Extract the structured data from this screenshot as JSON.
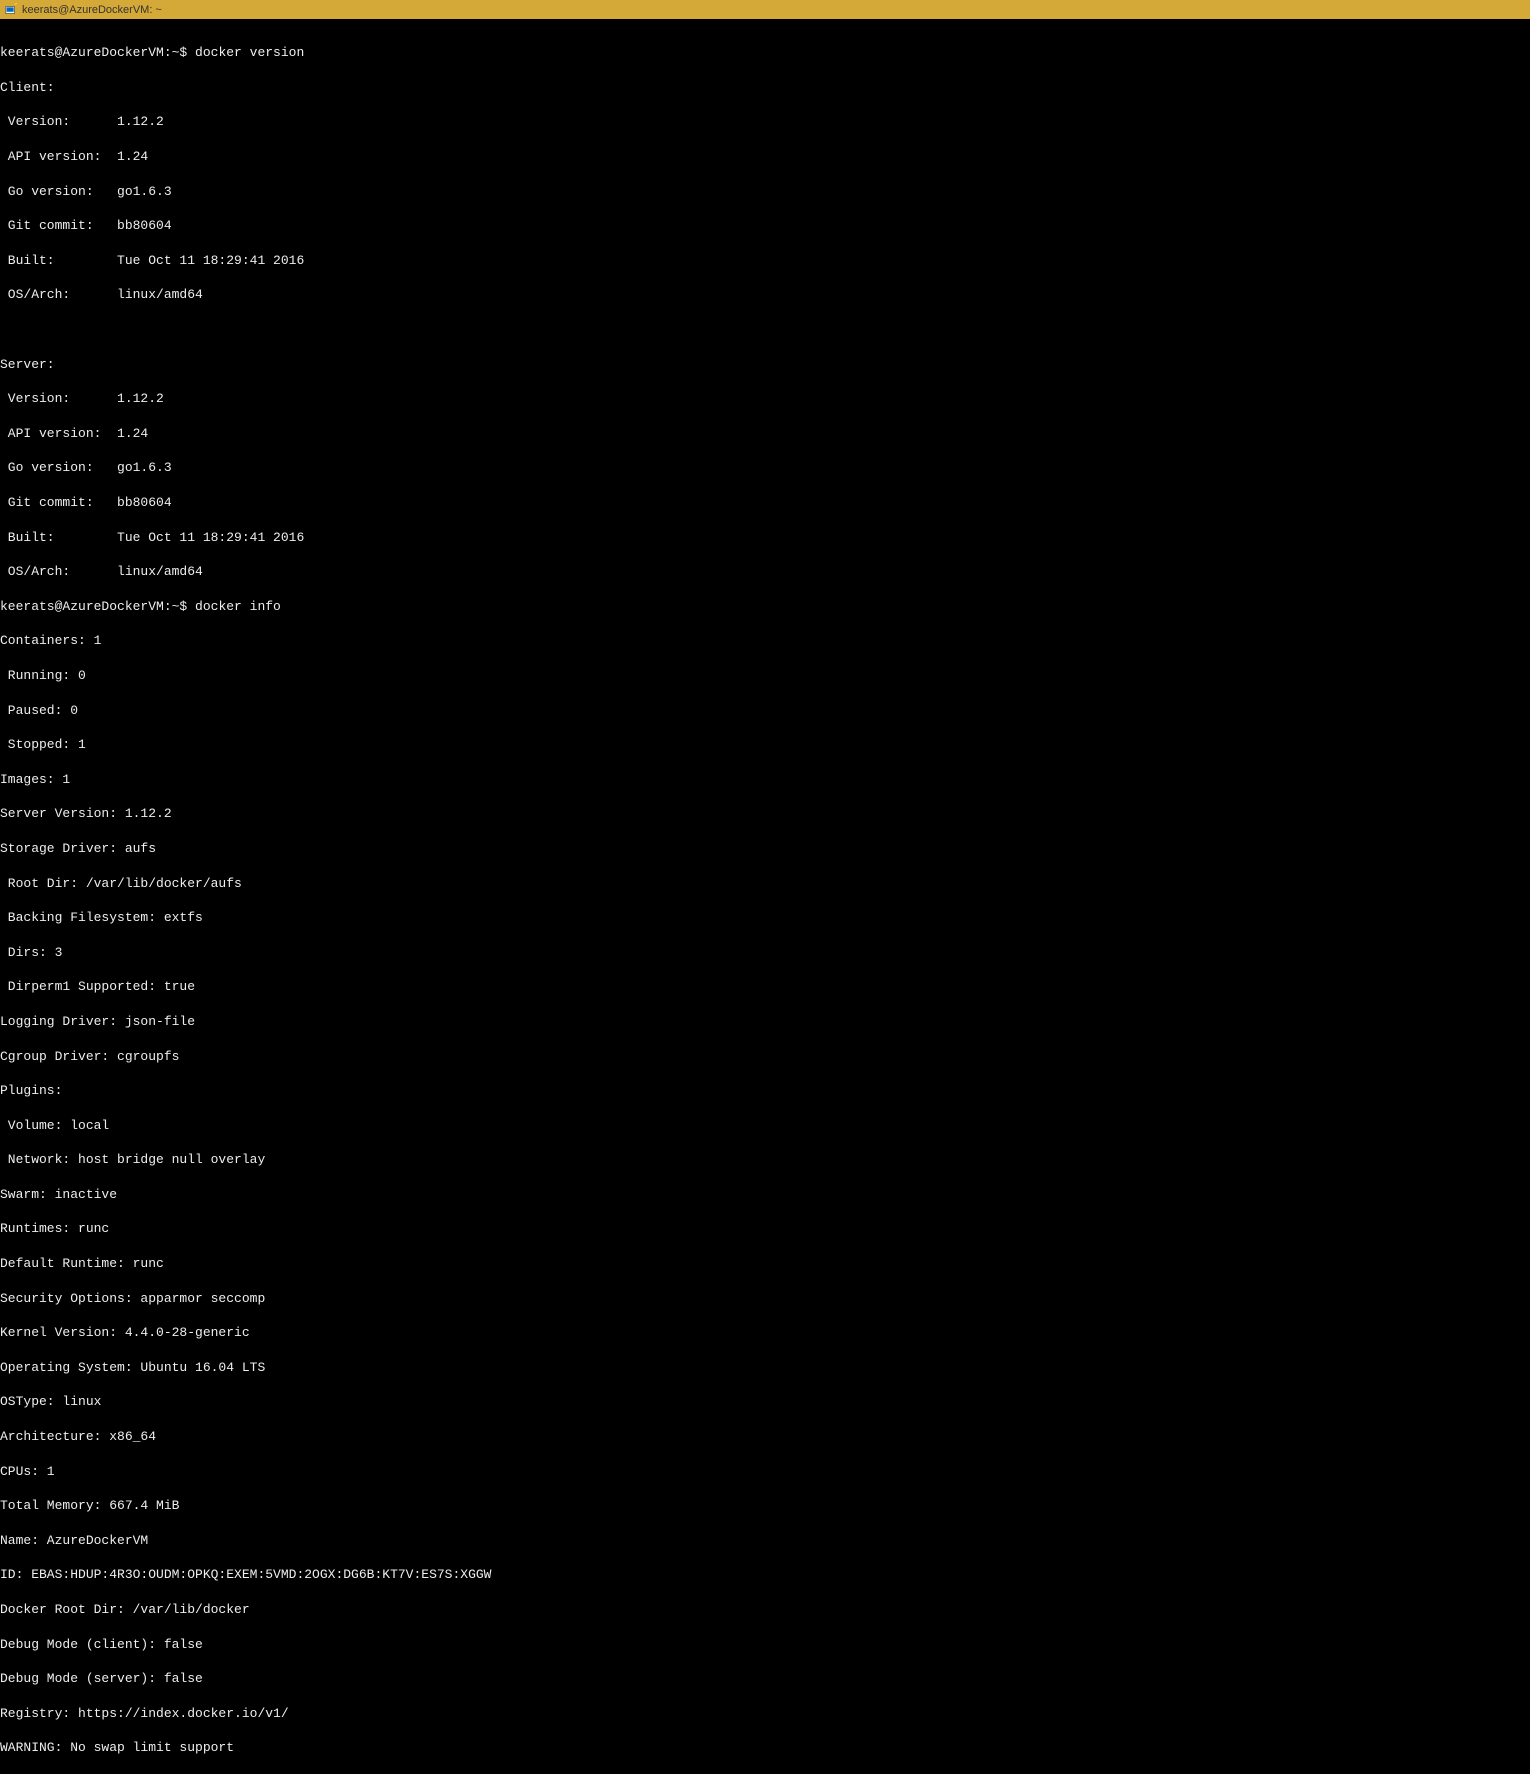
{
  "title": "keerats@AzureDockerVM: ~",
  "prompt": "keerats@AzureDockerVM:~$",
  "commands": {
    "version": "docker version",
    "info": "docker info"
  },
  "version_output": {
    "client_header": "Client:",
    "server_header": "Server:",
    "rows": [
      " Version:      1.12.2",
      " API version:  1.24",
      " Go version:   go1.6.3",
      " Git commit:   bb80604",
      " Built:        Tue Oct 11 18:29:41 2016",
      " OS/Arch:      linux/amd64"
    ]
  },
  "info_output": [
    "Containers: 1",
    " Running: 0",
    " Paused: 0",
    " Stopped: 1",
    "Images: 1",
    "Server Version: 1.12.2",
    "Storage Driver: aufs",
    " Root Dir: /var/lib/docker/aufs",
    " Backing Filesystem: extfs",
    " Dirs: 3",
    " Dirperm1 Supported: true",
    "Logging Driver: json-file",
    "Cgroup Driver: cgroupfs",
    "Plugins:",
    " Volume: local",
    " Network: host bridge null overlay",
    "Swarm: inactive",
    "Runtimes: runc",
    "Default Runtime: runc",
    "Security Options: apparmor seccomp",
    "Kernel Version: 4.4.0-28-generic",
    "Operating System: Ubuntu 16.04 LTS",
    "OSType: linux",
    "Architecture: x86_64",
    "CPUs: 1",
    "Total Memory: 667.4 MiB",
    "Name: AzureDockerVM",
    "ID: EBAS:HDUP:4R3O:OUDM:OPKQ:EXEM:5VMD:2OGX:DG6B:KT7V:ES7S:XGGW",
    "Docker Root Dir: /var/lib/docker",
    "Debug Mode (client): false",
    "Debug Mode (server): false",
    "Registry: https://index.docker.io/v1/",
    "WARNING: No swap limit support"
  ]
}
